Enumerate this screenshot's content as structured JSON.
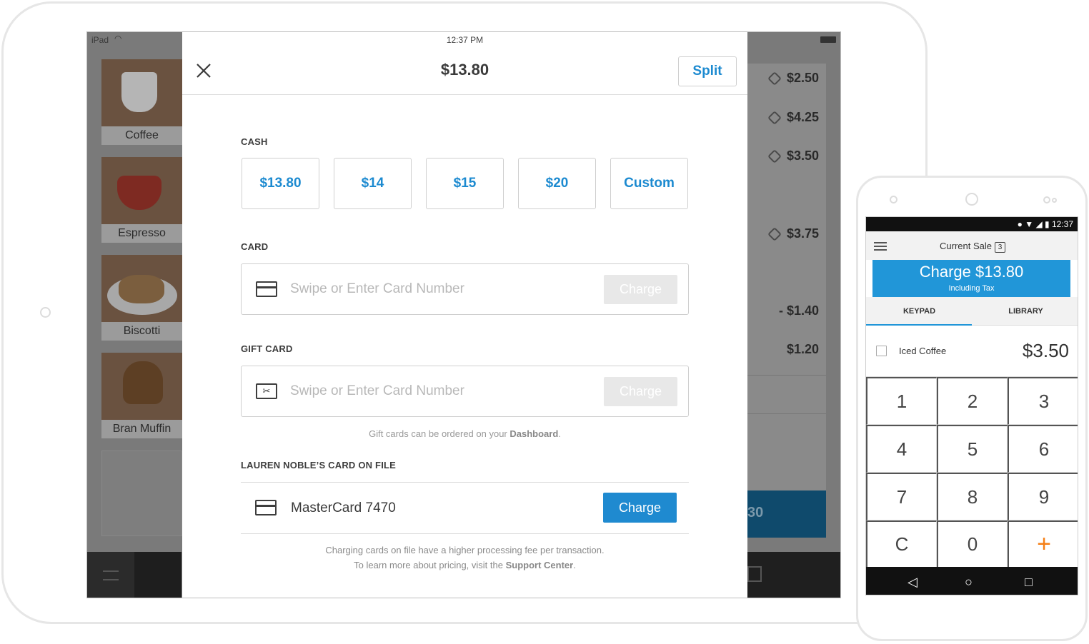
{
  "ipad": {
    "statusbar": {
      "device": "iPad",
      "time": "12:37 PM"
    },
    "products": [
      {
        "name": "Coffee"
      },
      {
        "name": "Espresso"
      },
      {
        "name": "Biscotti"
      },
      {
        "name": "Bran Muffin"
      }
    ],
    "bg_prices": [
      "$2.50",
      "$4.25",
      "$3.50",
      "$3.75",
      "- $1.40",
      "$1.20"
    ],
    "bg_charge_fragment": "30"
  },
  "modal": {
    "amount": "$13.80",
    "split_label": "Split",
    "cash": {
      "label": "CASH",
      "options": [
        "$13.80",
        "$14",
        "$15",
        "$20",
        "Custom"
      ]
    },
    "card": {
      "label": "CARD",
      "placeholder": "Swipe or Enter Card Number",
      "charge_label": "Charge"
    },
    "gift_card": {
      "label": "GIFT CARD",
      "placeholder": "Swipe or Enter Card Number",
      "charge_label": "Charge",
      "note_prefix": "Gift cards can be ordered on your ",
      "note_link": "Dashboard",
      "note_suffix": "."
    },
    "card_on_file": {
      "label": "LAUREN NOBLE’S CARD ON FILE",
      "card_name": "MasterCard 7470",
      "charge_label": "Charge",
      "note_line1": "Charging cards on file have a higher processing fee per transaction.",
      "note_line2_prefix": "To learn more about pricing, visit the ",
      "note_link": "Support Center",
      "note_suffix": "."
    }
  },
  "phone": {
    "status_time": "12:37",
    "title": "Current Sale",
    "count": "3",
    "charge_label": "Charge $13.80",
    "charge_sub": "Including Tax",
    "tabs": [
      "KEYPAD",
      "LIBRARY"
    ],
    "item": {
      "name": "Iced Coffee",
      "price": "$3.50"
    },
    "keys": [
      "1",
      "2",
      "3",
      "4",
      "5",
      "6",
      "7",
      "8",
      "9",
      "C",
      "0",
      "+"
    ],
    "accent": "#2196d8",
    "plus_color": "#f57f17"
  },
  "colors": {
    "primary": "#1c8ad0"
  }
}
